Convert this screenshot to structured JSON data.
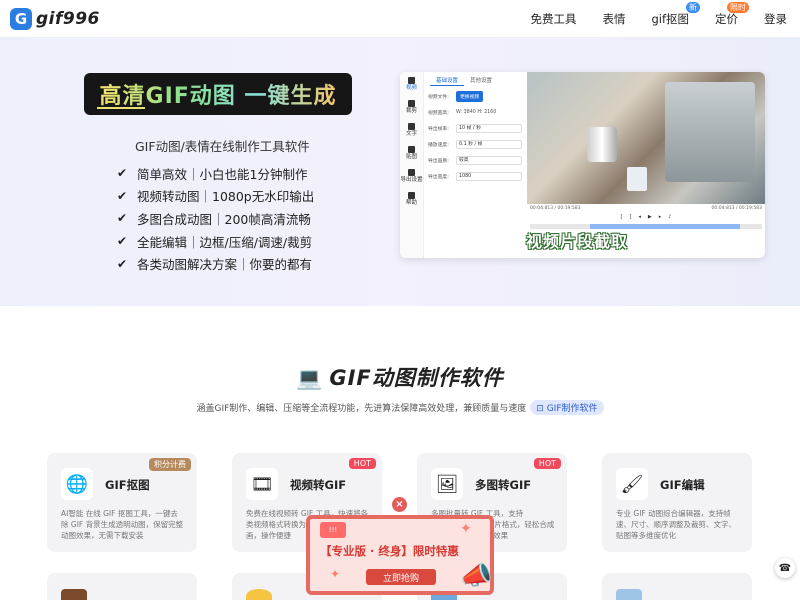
{
  "logo": {
    "badge": "G",
    "text": "gif996"
  },
  "nav": {
    "items": [
      {
        "label": "免费工具",
        "badge": ""
      },
      {
        "label": "表情",
        "badge": ""
      },
      {
        "label": "gif抠图",
        "badge": "新"
      },
      {
        "label": "定价",
        "badge": "限时"
      },
      {
        "label": "登录",
        "badge": ""
      }
    ]
  },
  "hero": {
    "title": "高清GIF动图 一键生成",
    "subtitle": "GIF动图/表情在线制作工具软件",
    "features": [
      "简单高效｜小白也能1分钟制作",
      "视频转动图｜1080p无水印输出",
      "多图合成动图｜200帧高清流畅",
      "全能编辑｜边框/压缩/调速/裁剪",
      "各类动图解决方案｜你要的都有"
    ],
    "demo": {
      "sidebar": [
        "视频",
        "裁剪",
        "文字",
        "贴图",
        "导出设置",
        "帮助"
      ],
      "tabs": [
        "基础设置",
        "其他设置"
      ],
      "rows": [
        {
          "label": "视频文件:",
          "value": "更换视频"
        },
        {
          "label": "视频宽高:",
          "value": "W: 3840  H: 2160"
        },
        {
          "label": "导出帧率:",
          "value": "10 帧 / 秒"
        },
        {
          "label": "播放速度:",
          "value": "0.1 秒 / 帧"
        },
        {
          "label": "导出画质:",
          "value": "较高"
        },
        {
          "label": "导出宽度:",
          "value": "1080"
        }
      ],
      "time_start": "00:04:813 / 00:19:583",
      "time_end": "00:04:813 / 00:19:583",
      "caption": "视频片段截取"
    }
  },
  "section": {
    "icon": "laptop-icon",
    "title": "GIF动图制作软件",
    "subtitle": "涵盖GIF制作、编辑、压缩等全流程功能，先进算法保障高效处理，兼顾质量与速度",
    "tag": "GIF制作软件"
  },
  "cards": [
    {
      "title": "GIF抠图",
      "badge": "积分计费",
      "desc": "AI智能 在线 GIF 抠图工具，一键去除 GIF 背景生成透明动图，保留完整动图效果，无需下载安装"
    },
    {
      "title": "视频转GIF",
      "badge": "HOT",
      "desc": "免费在线视频转 GIF 工具，快速将各类视频格式转换为高清 GIF 动图动画，操作便捷"
    },
    {
      "title": "多图转GIF",
      "badge": "HOT",
      "desc": "多图批量转 GIF 工具，支持 JPG/PNG 等多种图片格式，轻松合成高清流畅 GIF 动图效果"
    },
    {
      "title": "GIF编辑",
      "badge": "",
      "desc": "专业 GIF 动图综合编辑器，支持帧速、尺寸、顺序调整及裁剪、文字、贴图等多维度优化"
    }
  ],
  "promo": {
    "ticket": "!!!",
    "text": "【专业版 · 终身】限时特惠",
    "button": "立即抢购",
    "close": "×"
  },
  "colors": {
    "accent": "#2a7de1",
    "hot": "#f04a5c",
    "promo_red": "#d9493e"
  }
}
